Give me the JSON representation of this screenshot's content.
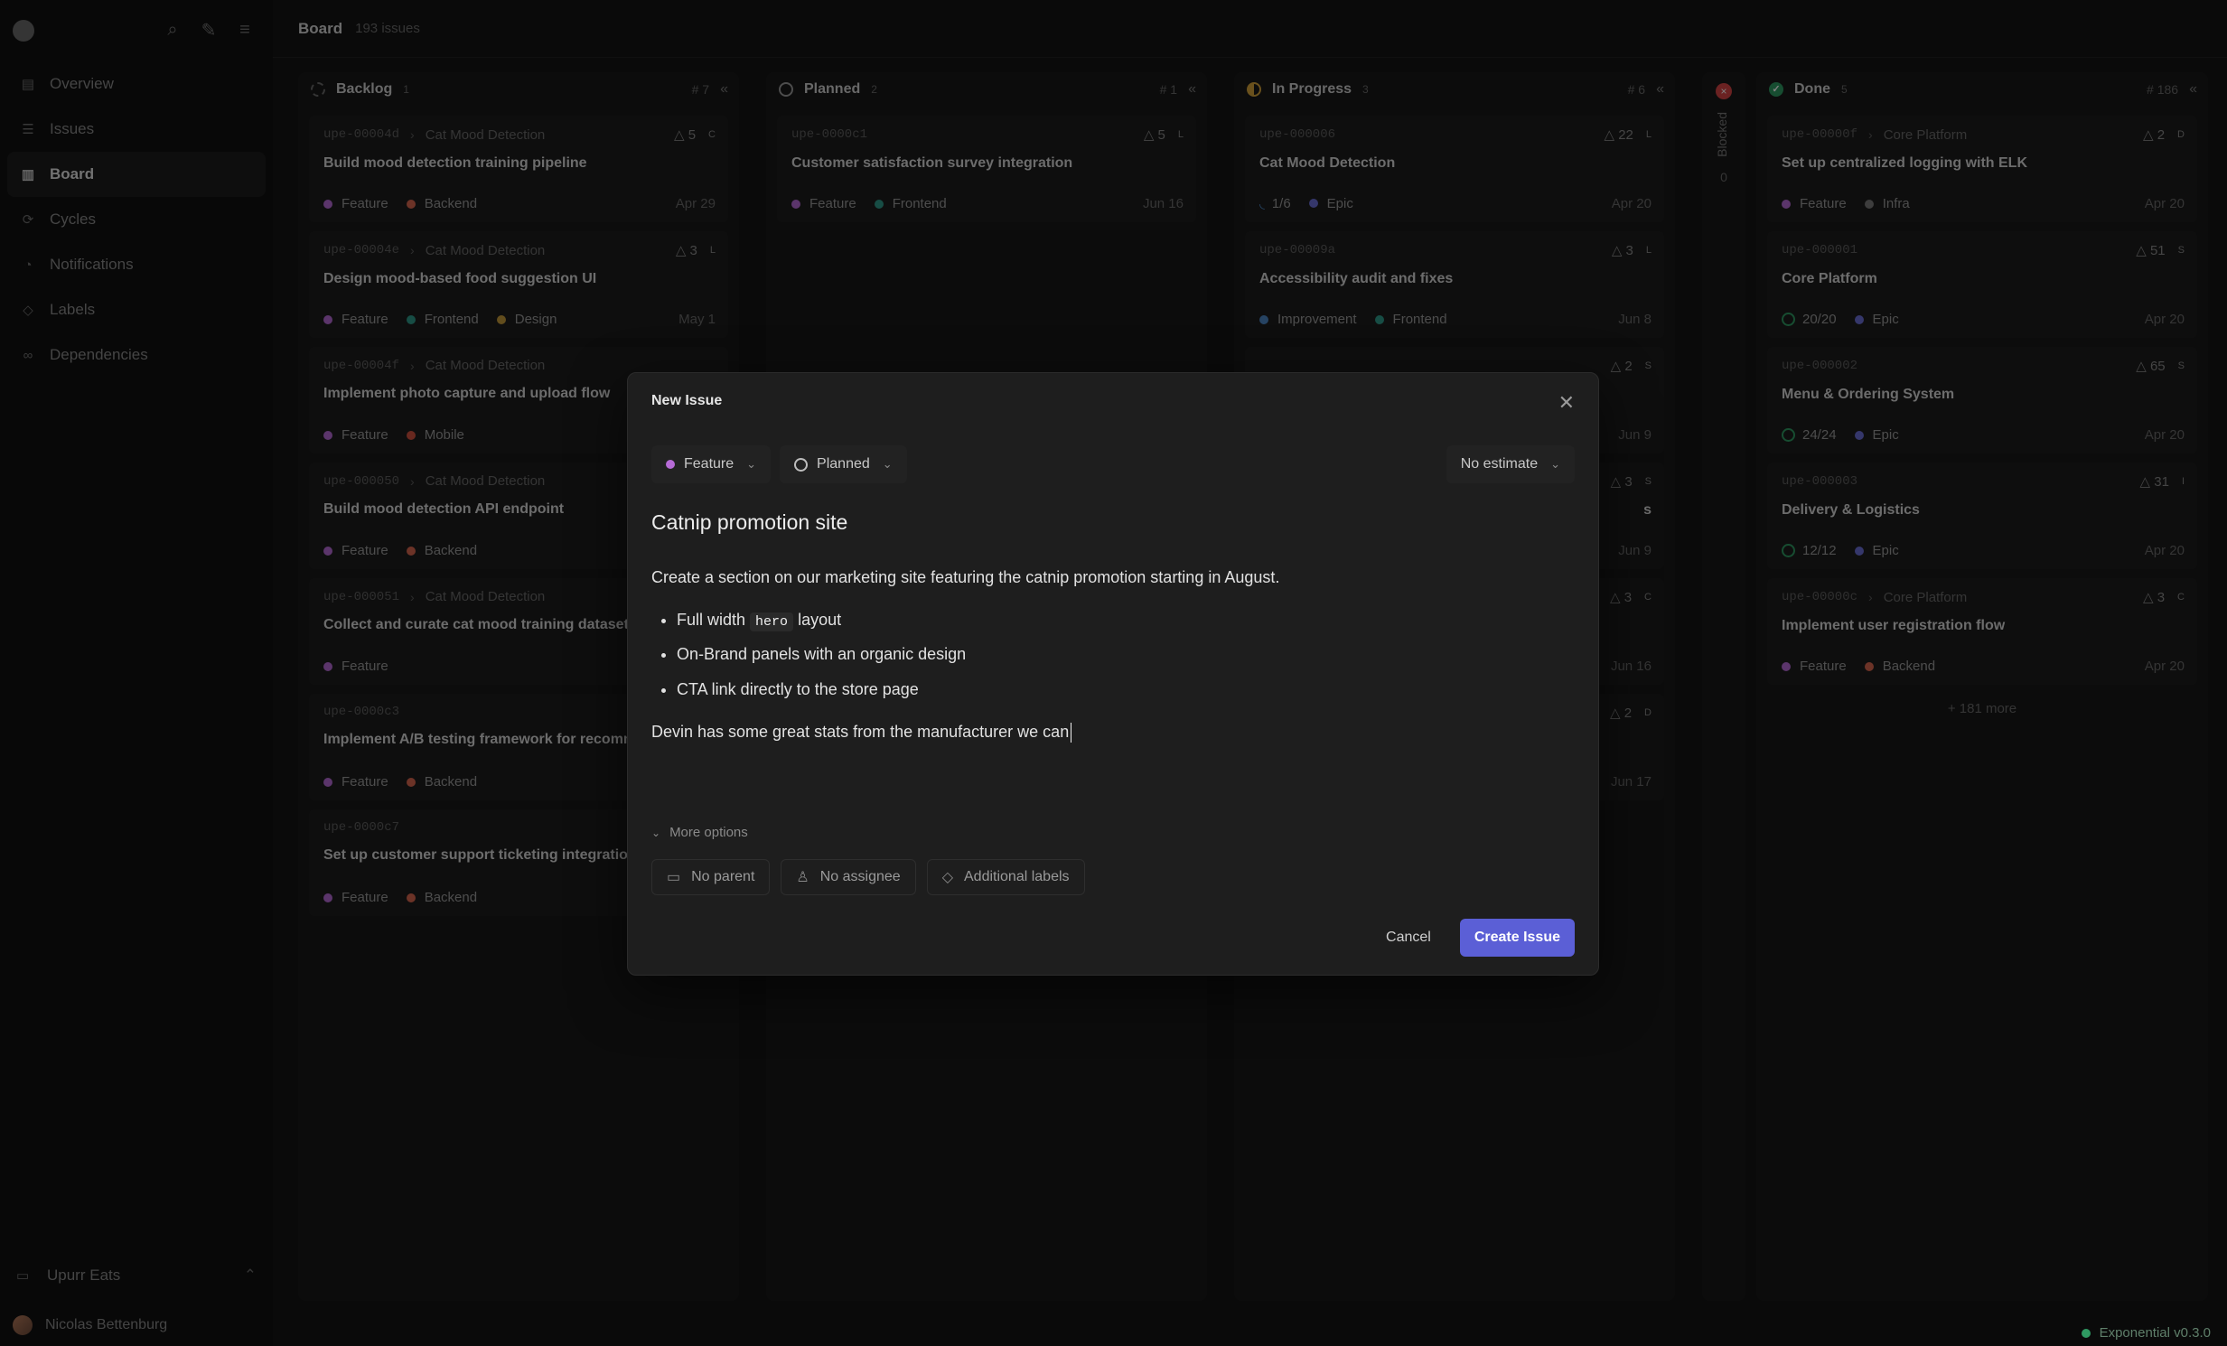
{
  "sidebar": {
    "nav": [
      {
        "label": "Overview",
        "icon": "overview-icon"
      },
      {
        "label": "Issues",
        "icon": "list-icon"
      },
      {
        "label": "Board",
        "icon": "board-icon"
      },
      {
        "label": "Cycles",
        "icon": "cycle-icon"
      },
      {
        "label": "Notifications",
        "icon": "bell-icon"
      },
      {
        "label": "Labels",
        "icon": "tag-icon"
      },
      {
        "label": "Dependencies",
        "icon": "link-icon"
      }
    ],
    "workspace": "Upurr Eats",
    "user": "Nicolas Bettenburg"
  },
  "header": {
    "title": "Board",
    "count": "193 issues"
  },
  "colors": {
    "feature": "#b66bd6",
    "backend": "#d9674f",
    "frontend": "#2f9a8a",
    "design": "#c49a3a",
    "mobile": "#d0513f",
    "epic": "#6b6ed6",
    "infra": "#7a7a7a",
    "improvement": "#4c86c4",
    "accent": "#5b5fd6"
  },
  "columns": [
    {
      "name": "Backlog",
      "n": "1",
      "hash": "# 7",
      "cards": [
        {
          "id": "upe-00004d",
          "parent": "Cat Mood Detection",
          "pri": "5",
          "size": "C",
          "title": "Build mood detection training pipeline",
          "tags": [
            "Feature",
            "Backend"
          ],
          "date": "Apr 29"
        },
        {
          "id": "upe-00004e",
          "parent": "Cat Mood Detection",
          "pri": "3",
          "size": "L",
          "title": "Design mood-based food suggestion UI",
          "tags": [
            "Feature",
            "Frontend",
            "Design"
          ],
          "date": "May 1"
        },
        {
          "id": "upe-00004f",
          "parent": "Cat Mood Detection",
          "title": "Implement photo capture and upload flow",
          "tags": [
            "Feature",
            "Mobile"
          ]
        },
        {
          "id": "upe-000050",
          "parent": "Cat Mood Detection",
          "title": "Build mood detection API endpoint",
          "tags": [
            "Feature",
            "Backend"
          ]
        },
        {
          "id": "upe-000051",
          "parent": "Cat Mood Detection",
          "title": "Collect and curate cat mood training dataset",
          "tags": [
            "Feature"
          ]
        },
        {
          "id": "upe-0000c3",
          "title": "Implement A/B testing framework for recomme",
          "tags": [
            "Feature",
            "Backend"
          ]
        },
        {
          "id": "upe-0000c7",
          "title": "Set up customer support ticketing integration",
          "tags": [
            "Feature",
            "Backend"
          ]
        }
      ]
    },
    {
      "name": "Planned",
      "n": "2",
      "hash": "# 1",
      "cards": [
        {
          "id": "upe-0000c1",
          "pri": "5",
          "size": "L",
          "title": "Customer satisfaction survey integration",
          "tags": [
            "Feature",
            "Frontend"
          ],
          "date": "Jun 16"
        }
      ]
    },
    {
      "name": "In Progress",
      "n": "3",
      "hash": "# 6",
      "cards": [
        {
          "id": "upe-000006",
          "pri": "22",
          "size": "L",
          "title": "Cat Mood Detection",
          "progress": "1/6",
          "tags": [
            "Epic"
          ],
          "date": "Apr 20"
        },
        {
          "id": "upe-00009a",
          "pri": "3",
          "size": "L",
          "title": "Accessibility audit and fixes",
          "tags": [
            "Improvement",
            "Frontend"
          ],
          "date": "Jun 8"
        },
        {
          "pri": "2",
          "size": "S",
          "date": "Jun 9"
        },
        {
          "pri": "3",
          "size": "S",
          "title_tail": "s",
          "date": "Jun 9"
        },
        {
          "pri": "3",
          "size": "C",
          "date": "Jun 16"
        },
        {
          "pri": "2",
          "size": "D",
          "date": "Jun 17"
        }
      ]
    },
    {
      "name": "Done",
      "n": "5",
      "hash": "# 186",
      "cards": [
        {
          "id": "upe-00000f",
          "parent": "Core Platform",
          "pri": "2",
          "size": "D",
          "title": "Set up centralized logging with ELK",
          "tags": [
            "Feature",
            "Infra"
          ],
          "date": "Apr 20"
        },
        {
          "id": "upe-000001",
          "pri": "51",
          "size": "S",
          "title": "Core Platform",
          "progress": "20/20",
          "tags": [
            "Epic"
          ],
          "date": "Apr 20"
        },
        {
          "id": "upe-000002",
          "pri": "65",
          "size": "S",
          "title": "Menu & Ordering System",
          "progress": "24/24",
          "tags": [
            "Epic"
          ],
          "date": "Apr 20"
        },
        {
          "id": "upe-000003",
          "pri": "31",
          "size": "I",
          "title": "Delivery & Logistics",
          "progress": "12/12",
          "tags": [
            "Epic"
          ],
          "date": "Apr 20"
        },
        {
          "id": "upe-00000c",
          "parent": "Core Platform",
          "pri": "3",
          "size": "C",
          "title": "Implement user registration flow",
          "tags": [
            "Feature",
            "Backend"
          ],
          "date": "Apr 20"
        }
      ],
      "more": "+ 181 more"
    }
  ],
  "blocked": {
    "label": "Blocked",
    "count": "0"
  },
  "modal": {
    "title": "New Issue",
    "type": "Feature",
    "status": "Planned",
    "estimate": "No estimate",
    "issue_title": "Catnip promotion site",
    "para1": "Create a section on our marketing site featuring the catnip promotion starting in August.",
    "bullet1_pre": "Full width",
    "bullet1_code": "hero",
    "bullet1_post": "layout",
    "bullet2": "On-Brand panels with an organic design",
    "bullet3": "CTA link directly to the store page",
    "para2": "Devin has some great stats from the manufacturer we can",
    "more_options": "More options",
    "parent": "No parent",
    "assignee": "No assignee",
    "labels": "Additional labels",
    "cancel": "Cancel",
    "create": "Create Issue"
  },
  "version": "Exponential v0.3.0"
}
